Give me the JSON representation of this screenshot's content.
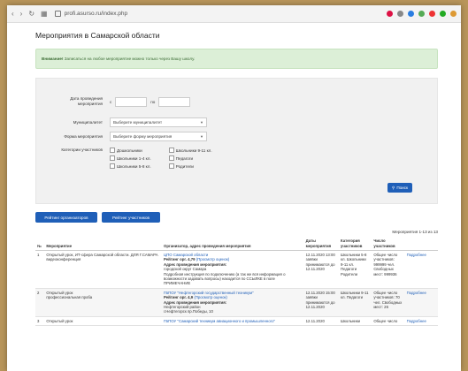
{
  "browser": {
    "url": "profi.asurso.ru/index.php"
  },
  "page": {
    "title": "Мероприятия в Самарской области"
  },
  "alert": {
    "label": "Внимание!",
    "text": " Записаться на любое мероприятие можно только через Вашу школу."
  },
  "filter": {
    "date_label_1": "Дата проведения",
    "date_label_2": "мероприятия",
    "from": "с",
    "to": "по",
    "mun_label": "Муниципалитет",
    "mun_value": "Выберите муниципалитет",
    "form_label": "Форма мероприятия",
    "form_value": "Выберите форму мероприятия",
    "cat_label": "Категории участников",
    "cats_col1": [
      "Дошкольники",
      "Школьники 1-4 кл.",
      "Школьники 5-8 кл."
    ],
    "cats_col2": [
      "Школьники 9-11 кл.",
      "Педагоги",
      "Родители"
    ],
    "search": "Поиск"
  },
  "buttons": {
    "org_rating": "Рейтинг организаторов",
    "participant_rating": "Рейтинг участников"
  },
  "counter": "Мероприятия 1-13 из 13",
  "table": {
    "headers": [
      "№",
      "Мероприятие",
      "Организатор, адрес проведения мероприятия",
      "Даты мероприятия",
      "Категория участников",
      "Число участников",
      ""
    ],
    "rows": [
      {
        "n": "1",
        "event": "Открытый урок, ИТ-сфера Самарской области. ДЛЯ Г.САМАРА",
        "event_sub": "видеоконференция",
        "org": "ЦПО Самарской области",
        "rating": "Рейтинг орг. 4,79",
        "rating_link": "(Просмотр оценок)",
        "addr_title": "Адрес проведения мероприятия:",
        "addr": "городской округ Самара",
        "addr2": "Подробная инструкция по подключению (а так же вся информация о возможности задавать вопросы) находится по ССЫЛКЕ в поле ПРИМЕЧАНИЕ",
        "dates": "12.11.2020 13:00",
        "dates2": "заявки принимаются до 12.11.2020",
        "cats": "Школьники 5-8 кл. Школьники 9-11 кл. Педагоги Родители",
        "count": "Общее число участников: 999999 чел. Свободных мест: 999936",
        "more": "Подробнее"
      },
      {
        "n": "2",
        "event": "Открытый урок",
        "event_sub": "профессиональная проба",
        "org": "ГБПОУ \"Нефтегорский государственный техникум\"",
        "rating": "Рейтинг орг. 4,9",
        "rating_link": "(Просмотр оценок)",
        "addr_title": "Адрес проведения мероприятия:",
        "addr": "Нефтегорский район",
        "addr2": "г.Нефтегорск пр.Победы, 10",
        "dates": "12.11.2020 15:00",
        "dates2": "заявки принимаются до 12.11.2020",
        "cats": "Школьники 9-11 кл. Педагоги",
        "count": "Общее число участников: 70 чел. Свободных мест: 26",
        "more": "Подробнее"
      },
      {
        "n": "3",
        "event": "Открытый урок",
        "org": "ГБПОУ \"Самарский техникум авиационного и промышленного\"",
        "dates": "12.11.2020",
        "cats": "Школьники",
        "count": "Общее число",
        "more": "Подробнее"
      }
    ]
  },
  "colors": {
    "accent": "#1f5fb8",
    "alert_bg": "#dcefd7",
    "alert_text": "#3c6d35"
  }
}
